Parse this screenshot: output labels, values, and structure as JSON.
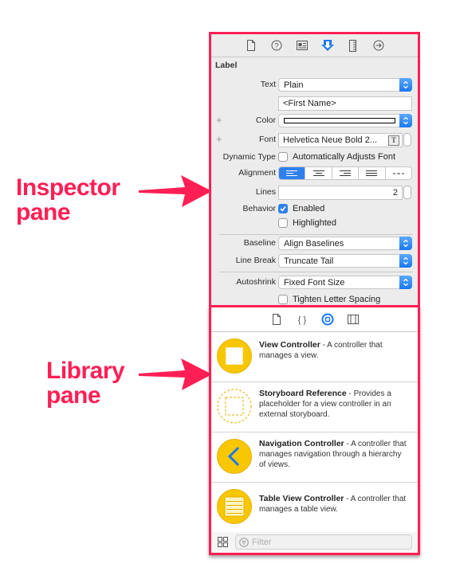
{
  "annotations": {
    "inspector_label_line1": "Inspector",
    "inspector_label_line2": "pane",
    "library_label_line1": "Library",
    "library_label_line2": "pane",
    "accent_color": "#ff1f54"
  },
  "inspector": {
    "tabs": [
      {
        "icon": "file-icon",
        "selected": false
      },
      {
        "icon": "help-icon",
        "selected": false
      },
      {
        "icon": "identity-icon",
        "selected": false
      },
      {
        "icon": "attributes-icon",
        "selected": true
      },
      {
        "icon": "ruler-icon",
        "selected": false
      },
      {
        "icon": "connections-icon",
        "selected": false
      }
    ],
    "section_title": "Label",
    "text": {
      "label": "Text",
      "value": "Plain"
    },
    "text_content": "<First Name>",
    "color": {
      "label": "Color"
    },
    "font": {
      "label": "Font",
      "value": "Helvetica Neue Bold 2..."
    },
    "dynamic_type": {
      "label": "Dynamic Type",
      "option": "Automatically Adjusts Font",
      "checked": false
    },
    "alignment": {
      "label": "Alignment",
      "options": [
        "left",
        "center",
        "right",
        "justified",
        "natural"
      ],
      "selected": "left"
    },
    "lines": {
      "label": "Lines",
      "value": "2"
    },
    "behavior": {
      "label": "Behavior",
      "enabled": "Enabled",
      "enabled_checked": true,
      "highlighted": "Highlighted",
      "highlighted_checked": false
    },
    "baseline": {
      "label": "Baseline",
      "value": "Align Baselines"
    },
    "line_break": {
      "label": "Line Break",
      "value": "Truncate Tail"
    },
    "autoshrink": {
      "label": "Autoshrink",
      "value": "Fixed Font Size"
    },
    "tighten": {
      "option": "Tighten Letter Spacing",
      "checked": false
    }
  },
  "library": {
    "tabs": [
      {
        "icon": "file-template-icon",
        "selected": false
      },
      {
        "icon": "code-snippet-icon",
        "selected": false
      },
      {
        "icon": "object-library-icon",
        "selected": true
      },
      {
        "icon": "media-library-icon",
        "selected": false
      }
    ],
    "items": [
      {
        "title": "View Controller",
        "desc": " - A controller that manages a view."
      },
      {
        "title": "Storyboard Reference",
        "desc": " - Provides a placeholder for a view controller in an external storyboard."
      },
      {
        "title": "Navigation Controller",
        "desc": " - A controller that manages navigation through a hierarchy of views."
      },
      {
        "title": "Table View Controller",
        "desc": " - A controller that manages a table view."
      }
    ],
    "filter_placeholder": "Filter"
  }
}
